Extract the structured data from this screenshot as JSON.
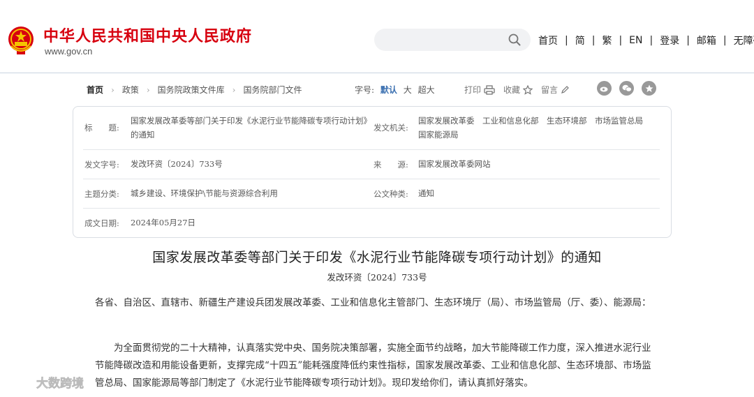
{
  "header": {
    "site_name": "中华人民共和国中央人民政府",
    "site_domain": "www.gov.cn",
    "search": {
      "placeholder": "",
      "value": ""
    },
    "nav": [
      "首页",
      "简",
      "繁",
      "EN",
      "登录",
      "邮箱",
      "无障碍"
    ]
  },
  "toolbar": {
    "breadcrumb": [
      "首页",
      "政策",
      "国务院政策文件库",
      "国务院部门文件"
    ],
    "fontsize_label": "字号:",
    "fontsize_options": [
      "默认",
      "大",
      "超大"
    ],
    "fontsize_selected": "默认",
    "print_label": "打印",
    "favorite_label": "收藏",
    "comment_label": "留言",
    "share_icons": [
      "weibo-icon",
      "wechat-icon",
      "qzone-icon"
    ]
  },
  "metadata": {
    "title_label": "标　　题:",
    "title_value": "国家发展改革委等部门关于印发《水泥行业节能降碳专项行动计划》的通知",
    "issuer_label": "发文机关:",
    "issuer_value": "国家发展改革委　工业和信息化部　生态环境部　市场监管总局　国家能源局",
    "docno_label": "发文字号:",
    "docno_value": "发改环资〔2024〕733号",
    "source_label": "来　　源:",
    "source_value": "国家发展改革委网站",
    "category_label": "主题分类:",
    "category_value": "城乡建设、环境保护\\节能与资源综合利用",
    "type_label": "公文种类:",
    "type_value": "通知",
    "date_label": "成文日期:",
    "date_value": "2024年05月27日"
  },
  "article": {
    "title": "国家发展改革委等部门关于印发《水泥行业节能降碳专项行动计划》的通知",
    "doc_no": "发改环资〔2024〕733号",
    "recipients": "各省、自治区、直辖市、新疆生产建设兵团发展改革委、工业和信息化主管部门、生态环境厅（局）、市场监管局（厅、委）、能源局：",
    "body": "为全面贯彻党的二十大精神，认真落实党中央、国务院决策部署，实施全面节约战略，加大节能降碳工作力度，深入推进水泥行业节能降碳改造和用能设备更新，支撑完成“十四五”能耗强度降低约束性指标，国家发展改革委、工业和信息化部、生态环境部、市场监管总局、国家能源局等部门制定了《水泥行业节能降碳专项行动计划》。现印发给你们，请认真抓好落实。"
  },
  "watermark": {
    "text": "大数跨境"
  },
  "colors": {
    "brand_red": "#d7000f",
    "accent_blue": "#3a6fb0",
    "divider": "#c9d4e0"
  }
}
